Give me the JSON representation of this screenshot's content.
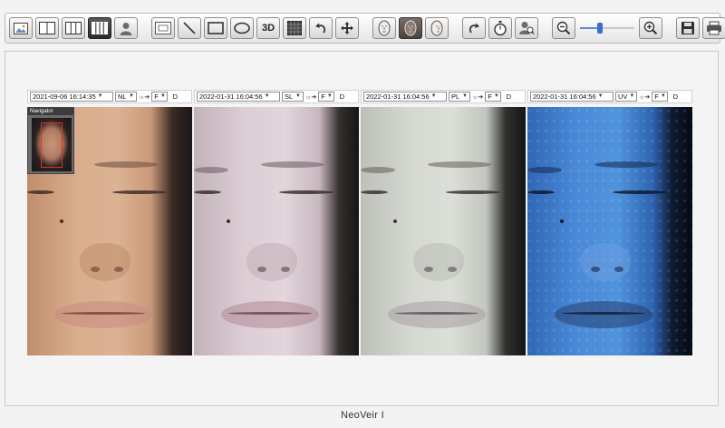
{
  "toolbar": {
    "three_d_label": "3D",
    "zoom_slider": {
      "value": 0.35
    }
  },
  "panels": [
    {
      "date": "2021-09-06 16:14:35",
      "mode": "NL",
      "face": "F",
      "d_label": "D"
    },
    {
      "date": "2022-01-31 16:04:56",
      "mode": "SL",
      "face": "F",
      "d_label": "D"
    },
    {
      "date": "2022-01-31 16:04:56",
      "mode": "PL",
      "face": "F",
      "d_label": "D"
    },
    {
      "date": "2022-01-31 16:04:56",
      "mode": "UV",
      "face": "F",
      "d_label": "D"
    }
  ],
  "navigator": {
    "title": "Navigator"
  },
  "footer": {
    "title": "NeoVeir I"
  },
  "colors": {
    "nl_skin": "#d7ab8a",
    "sl_skin": "#d9cbd2",
    "pl_skin": "#d3d6d0",
    "uv_skin": "#3f7fd0"
  }
}
